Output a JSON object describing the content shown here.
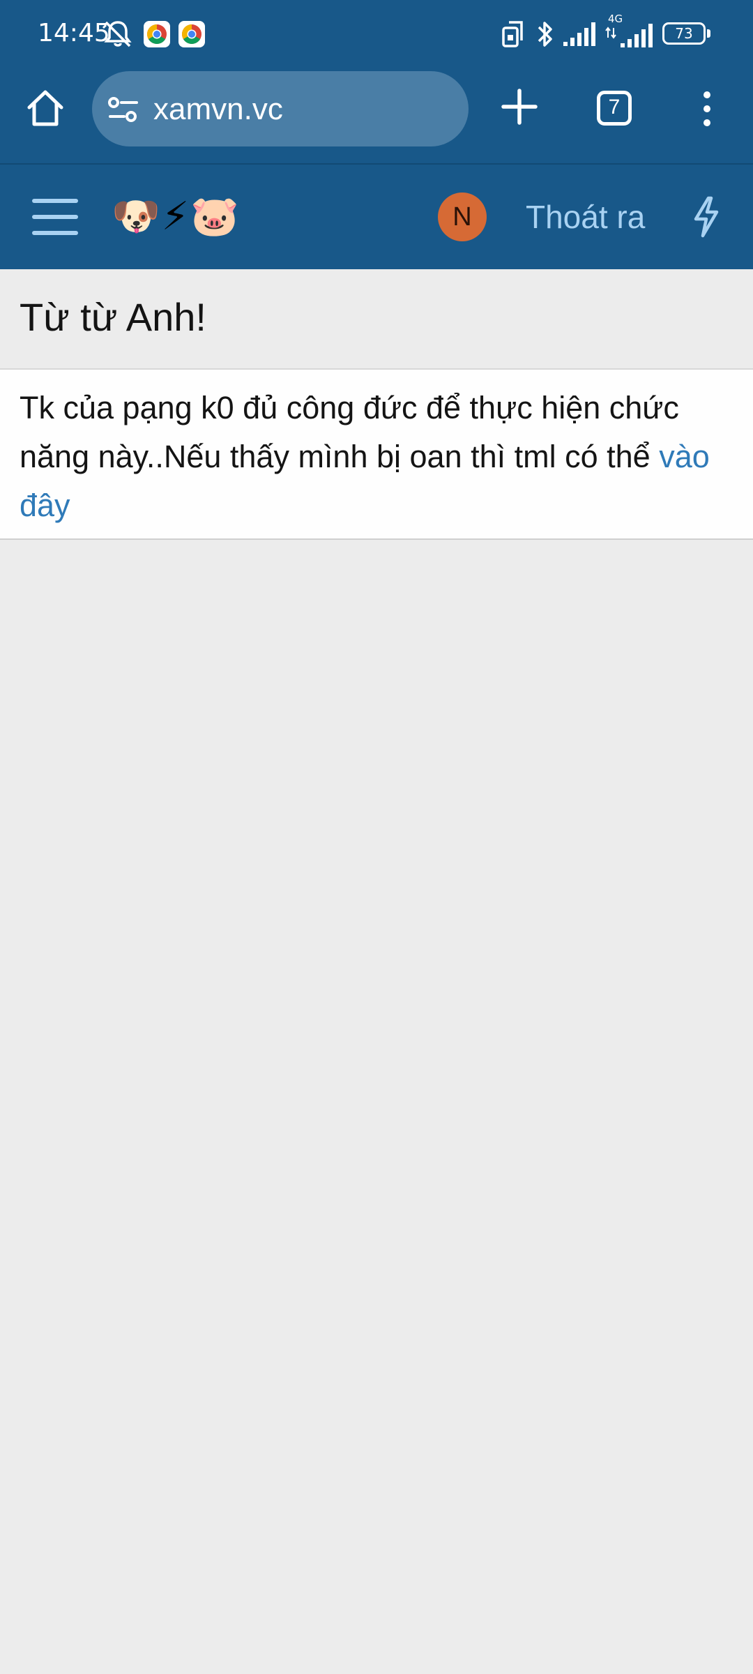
{
  "status_bar": {
    "time": "14:45",
    "battery_level": "73",
    "network_label": "4G",
    "icons": [
      "mute-bell-icon",
      "chrome-icon",
      "chrome-icon",
      "rotate-lock-icon",
      "bluetooth-icon",
      "signal-icon",
      "signal-4g-icon",
      "battery-icon"
    ]
  },
  "browser": {
    "url": "xamvn.vc",
    "tab_count": "7",
    "icons": [
      "home-icon",
      "tune-icon",
      "plus-icon",
      "tabs-icon",
      "more-vert-icon"
    ]
  },
  "site_header": {
    "logo_text": "🐶⚡🐷",
    "avatar_initial": "N",
    "logout_label": "Thoát ra",
    "icons": [
      "hamburger-icon",
      "bolt-icon"
    ],
    "colors": {
      "header_bg": "#185889",
      "avatar_bg": "#d66a35",
      "link": "#a9d2f2"
    }
  },
  "main": {
    "title": "Từ từ Anh!",
    "notice_text": "Tk của pạng k0 đủ công đức để thực hiện chức năng này..Nếu thấy mình bị oan thì tml có thể ",
    "notice_link": "vào đây",
    "colors": {
      "link": "#2f7ab8",
      "page_bg": "#ececec"
    }
  }
}
